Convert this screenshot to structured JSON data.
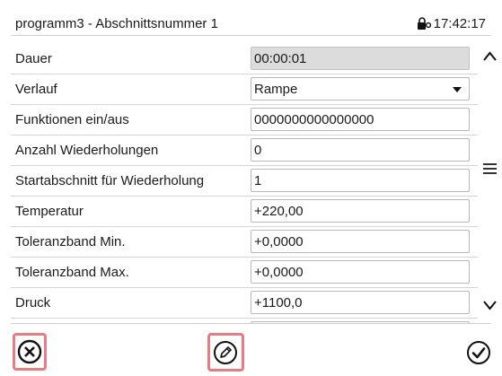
{
  "header": {
    "title": "programm3 - Abschnittsnummer 1",
    "time": "17:42:17"
  },
  "rows": [
    {
      "label": "Dauer",
      "value": "00:00:01",
      "readonly": true
    },
    {
      "label": "Verlauf",
      "value": "Rampe",
      "dropdown": true
    },
    {
      "label": "Funktionen ein/aus",
      "value": "0000000000000000"
    },
    {
      "label": "Anzahl Wiederholungen",
      "value": "0"
    },
    {
      "label": "Startabschnitt für Wiederholung",
      "value": "1"
    },
    {
      "label": "Temperatur",
      "value": "+220,00"
    },
    {
      "label": "Toleranzband Min.",
      "value": "+0,0000"
    },
    {
      "label": "Toleranzband Max.",
      "value": "+0,0000"
    },
    {
      "label": "Druck",
      "value": "+1100,0"
    }
  ],
  "colors": {
    "highlight": "#e87a80",
    "readonly_field": "#dcdcdc"
  },
  "icons": [
    "lock-icon",
    "scroll-up-icon",
    "menu-icon",
    "scroll-down-icon",
    "cancel-icon",
    "edit-icon",
    "confirm-icon"
  ]
}
